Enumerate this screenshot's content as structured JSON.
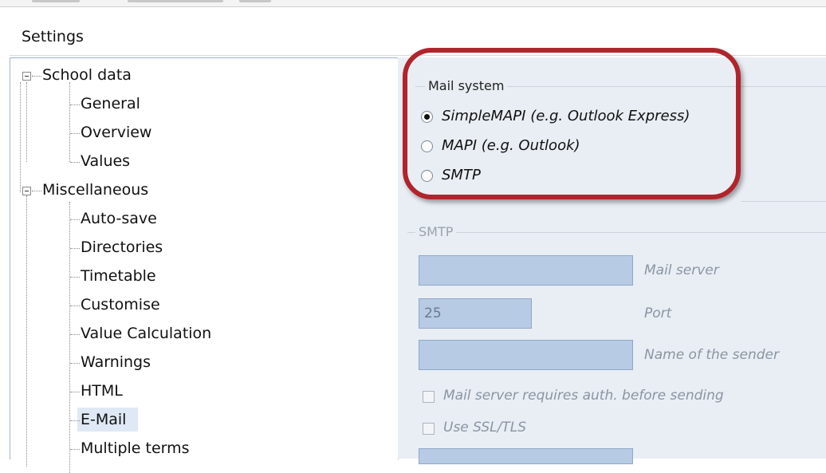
{
  "window": {
    "title": "Settings"
  },
  "tree": {
    "groups": [
      {
        "label": "School data",
        "children": [
          "General",
          "Overview",
          "Values"
        ]
      },
      {
        "label": "Miscellaneous",
        "children": [
          "Auto-save",
          "Directories",
          "Timetable",
          "Customise",
          "Value Calculation",
          "Warnings",
          "HTML",
          "E-Mail",
          "Multiple terms"
        ]
      }
    ],
    "selected": "E-Mail"
  },
  "mail_system": {
    "legend": "Mail system",
    "options": [
      {
        "label": "SimpleMAPI (e.g. Outlook Express)",
        "checked": true
      },
      {
        "label": "MAPI (e.g. Outlook)",
        "checked": false
      },
      {
        "label": "SMTP",
        "checked": false
      }
    ]
  },
  "smtp": {
    "legend": "SMTP",
    "mail_server": {
      "value": "",
      "label": "Mail server"
    },
    "port": {
      "value": "25",
      "label": "Port"
    },
    "sender_name": {
      "value": "",
      "label": "Name of the sender"
    },
    "auth_checkbox": {
      "label": "Mail server requires auth. before sending",
      "checked": false
    },
    "ssl_checkbox": {
      "label": "Use SSL/TLS",
      "checked": false
    }
  },
  "colors": {
    "highlight": "#b0242c",
    "disabled_field": "#b8cbe4",
    "panel": "#e9eef4"
  }
}
